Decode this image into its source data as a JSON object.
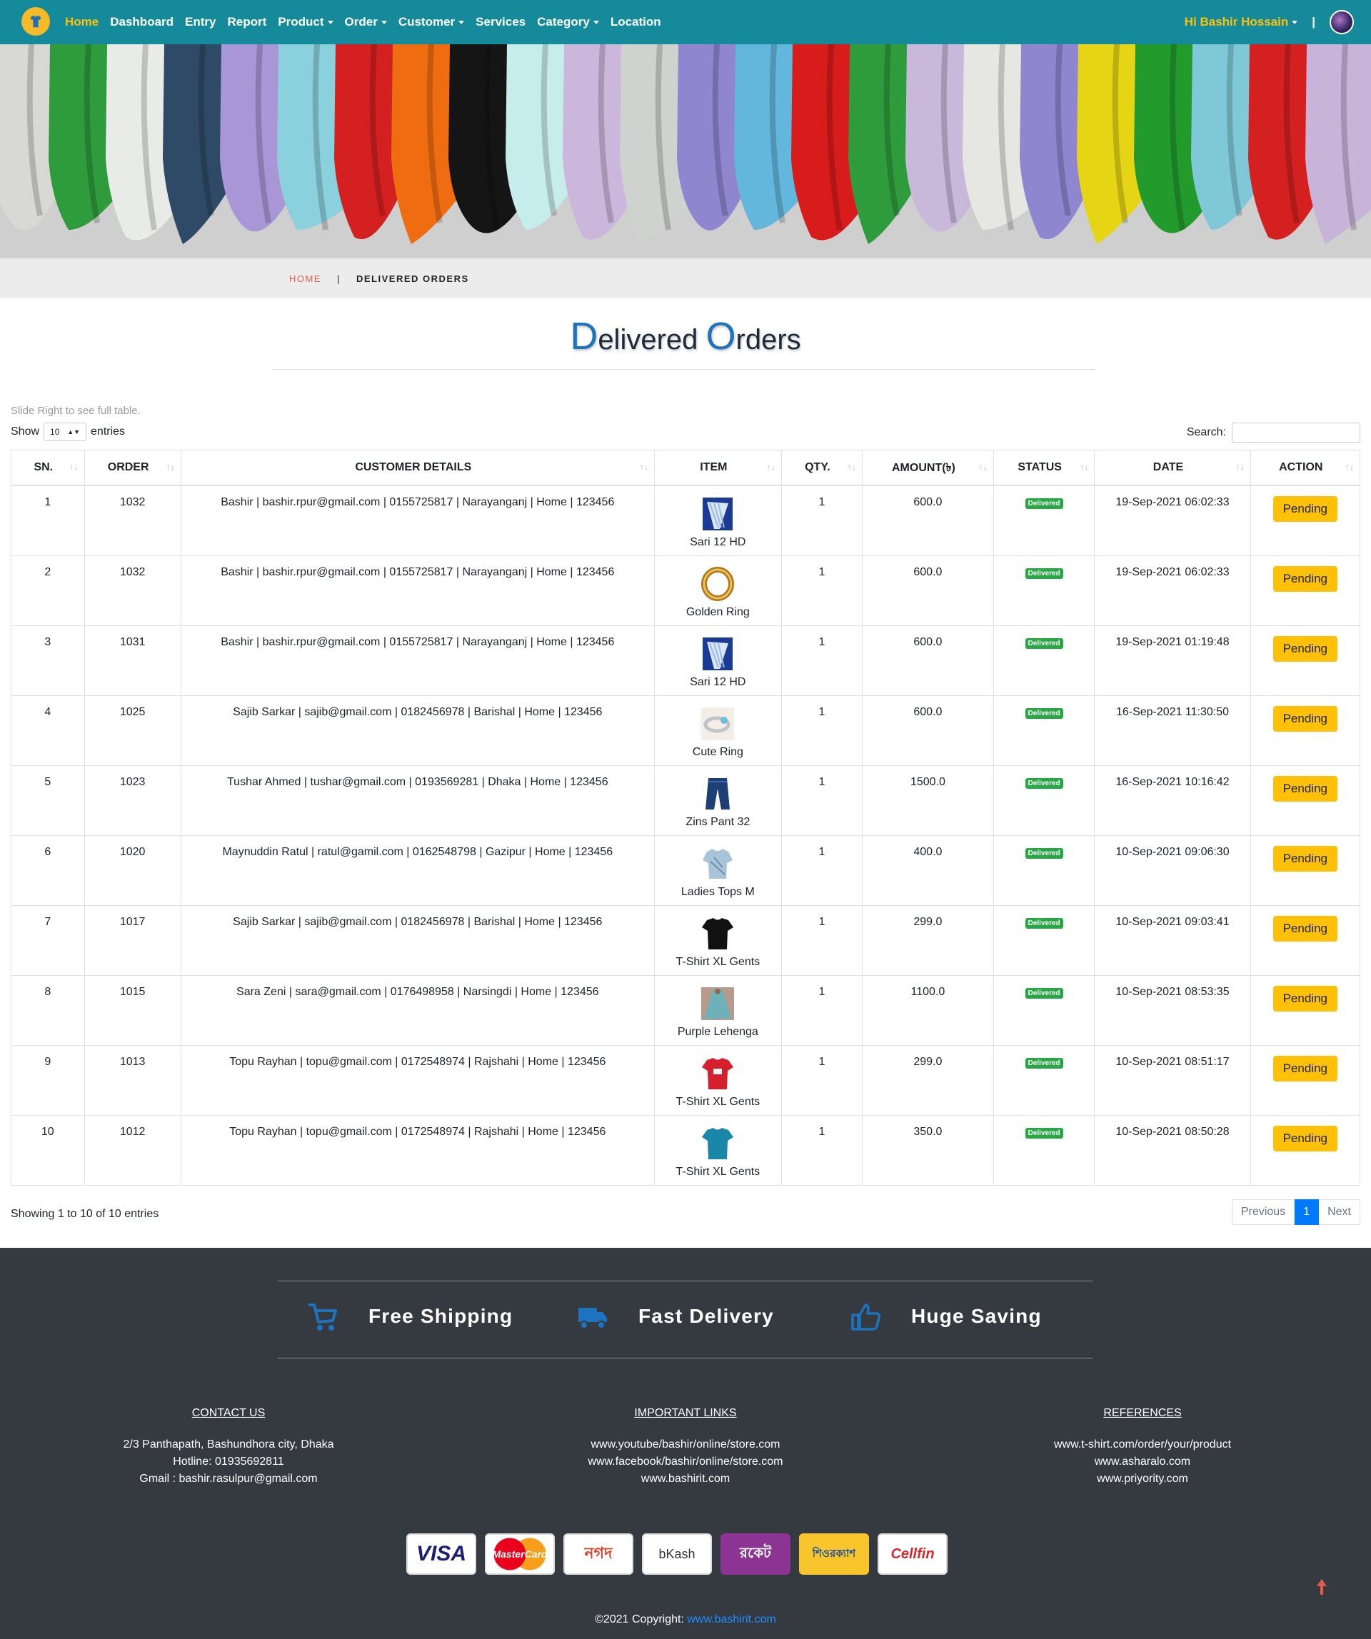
{
  "nav": {
    "items": [
      {
        "label": "Home",
        "active": true,
        "dropdown": false
      },
      {
        "label": "Dashboard",
        "active": false,
        "dropdown": false
      },
      {
        "label": "Entry",
        "active": false,
        "dropdown": false
      },
      {
        "label": "Report",
        "active": false,
        "dropdown": false
      },
      {
        "label": "Product",
        "active": false,
        "dropdown": true
      },
      {
        "label": "Order",
        "active": false,
        "dropdown": true
      },
      {
        "label": "Customer",
        "active": false,
        "dropdown": true
      },
      {
        "label": "Services",
        "active": false,
        "dropdown": false
      },
      {
        "label": "Category",
        "active": false,
        "dropdown": true
      },
      {
        "label": "Location",
        "active": false,
        "dropdown": false
      }
    ],
    "greeting": "Hi",
    "user_name": "Bashir Hossain",
    "separator": "|"
  },
  "breadcrumb": {
    "home": "HOME",
    "separator": "|",
    "current": "DELIVERED ORDERS"
  },
  "page_title": {
    "first_letter": "D",
    "first_rest": "elivered",
    "second_letter": "O",
    "second_rest": "rders"
  },
  "table_controls": {
    "hint": "Slide Right to see full table.",
    "show_label": "Show",
    "page_size": "10",
    "entries_label": "entries",
    "search_label": "Search:",
    "search_value": ""
  },
  "table": {
    "headers": [
      "SN.",
      "ORDER",
      "CUSTOMER DETAILS",
      "ITEM",
      "QTY.",
      "AMOUNT(৳)",
      "STATUS",
      "DATE",
      "ACTION"
    ],
    "rows": [
      {
        "sn": "1",
        "order": "1032",
        "customer": "Bashir | bashir.rpur@gmail.com | 0155725817 | Narayanganj | Home | 123456",
        "item": "Sari 12 HD",
        "item_icon": "sari-icon",
        "qty": "1",
        "amount": "600.0",
        "status": "Delivered",
        "date": "19-Sep-2021 06:02:33",
        "action": "Pending"
      },
      {
        "sn": "2",
        "order": "1032",
        "customer": "Bashir | bashir.rpur@gmail.com | 0155725817 | Narayanganj | Home | 123456",
        "item": "Golden Ring",
        "item_icon": "ring-icon",
        "qty": "1",
        "amount": "600.0",
        "status": "Delivered",
        "date": "19-Sep-2021 06:02:33",
        "action": "Pending"
      },
      {
        "sn": "3",
        "order": "1031",
        "customer": "Bashir | bashir.rpur@gmail.com | 0155725817 | Narayanganj | Home | 123456",
        "item": "Sari 12 HD",
        "item_icon": "sari-icon",
        "qty": "1",
        "amount": "600.0",
        "status": "Delivered",
        "date": "19-Sep-2021 01:19:48",
        "action": "Pending"
      },
      {
        "sn": "4",
        "order": "1025",
        "customer": "Sajib Sarkar | sajib@gmail.com | 0182456978 | Barishal | Home | 123456",
        "item": "Cute Ring",
        "item_icon": "cute-ring-icon",
        "qty": "1",
        "amount": "600.0",
        "status": "Delivered",
        "date": "16-Sep-2021 11:30:50",
        "action": "Pending"
      },
      {
        "sn": "5",
        "order": "1023",
        "customer": "Tushar Ahmed | tushar@gmail.com | 0193569281 | Dhaka | Home | 123456",
        "item": "Zins Pant 32",
        "item_icon": "jeans-icon",
        "qty": "1",
        "amount": "1500.0",
        "status": "Delivered",
        "date": "16-Sep-2021 10:16:42",
        "action": "Pending"
      },
      {
        "sn": "6",
        "order": "1020",
        "customer": "Maynuddin Ratul | ratul@gamil.com | 0162548798 | Gazipur | Home | 123456",
        "item": "Ladies Tops M",
        "item_icon": "ladies-top-icon",
        "qty": "1",
        "amount": "400.0",
        "status": "Delivered",
        "date": "10-Sep-2021 09:06:30",
        "action": "Pending"
      },
      {
        "sn": "7",
        "order": "1017",
        "customer": "Sajib Sarkar | sajib@gmail.com | 0182456978 | Barishal | Home | 123456",
        "item": "T-Shirt XL Gents",
        "item_icon": "tshirt-black-icon",
        "qty": "1",
        "amount": "299.0",
        "status": "Delivered",
        "date": "10-Sep-2021 09:03:41",
        "action": "Pending"
      },
      {
        "sn": "8",
        "order": "1015",
        "customer": "Sara Zeni | sara@gmail.com | 0176498958 | Narsingdi | Home | 123456",
        "item": "Purple Lehenga",
        "item_icon": "lehenga-icon",
        "qty": "1",
        "amount": "1100.0",
        "status": "Delivered",
        "date": "10-Sep-2021 08:53:35",
        "action": "Pending"
      },
      {
        "sn": "9",
        "order": "1013",
        "customer": "Topu Rayhan | topu@gmail.com | 0172548974 | Rajshahi | Home | 123456",
        "item": "T-Shirt XL Gents",
        "item_icon": "tshirt-red-icon",
        "qty": "1",
        "amount": "299.0",
        "status": "Delivered",
        "date": "10-Sep-2021 08:51:17",
        "action": "Pending"
      },
      {
        "sn": "10",
        "order": "1012",
        "customer": "Topu Rayhan | topu@gmail.com | 0172548974 | Rajshahi | Home | 123456",
        "item": "T-Shirt XL Gents",
        "item_icon": "tshirt-teal-icon",
        "qty": "1",
        "amount": "350.0",
        "status": "Delivered",
        "date": "10-Sep-2021 08:50:28",
        "action": "Pending"
      }
    ]
  },
  "pagination": {
    "summary": "Showing 1 to 10 of 10 entries",
    "previous": "Previous",
    "current": "1",
    "next": "Next"
  },
  "footer": {
    "features": [
      {
        "icon": "cart-icon",
        "label": "Free Shipping"
      },
      {
        "icon": "truck-icon",
        "label": "Fast Delivery"
      },
      {
        "icon": "thumbs-up-icon",
        "label": "Huge Saving"
      }
    ],
    "contact": {
      "heading": "CONTACT US",
      "lines": [
        "2/3 Panthapath, Bashundhora city, Dhaka",
        "Hotline: 01935692811",
        "Gmail : bashir.rasulpur@gmail.com"
      ]
    },
    "links": {
      "heading": "IMPORTANT LINKS",
      "lines": [
        "www.youtube/bashir/online/store.com",
        "www.facebook/bashir/online/store.com",
        "www.bashirit.com"
      ]
    },
    "references": {
      "heading": "REFERENCES",
      "lines": [
        "www.t-shirt.com/order/your/product",
        "www.asharalo.com",
        "www.priyority.com"
      ]
    },
    "payments": [
      "VISA",
      "MasterCard",
      "নগদ",
      "bKash",
      "রকেট",
      "শিওরক্যাশ",
      "Cellfin"
    ],
    "copyright_text": "©2021 Copyright:",
    "copyright_link": "www.bashirit.com"
  },
  "colors": {
    "navbar": "#148a9a",
    "accent": "#ffc107",
    "title_blue": "#1e73be",
    "footer": "#343a40",
    "delivered": "#28a745"
  }
}
